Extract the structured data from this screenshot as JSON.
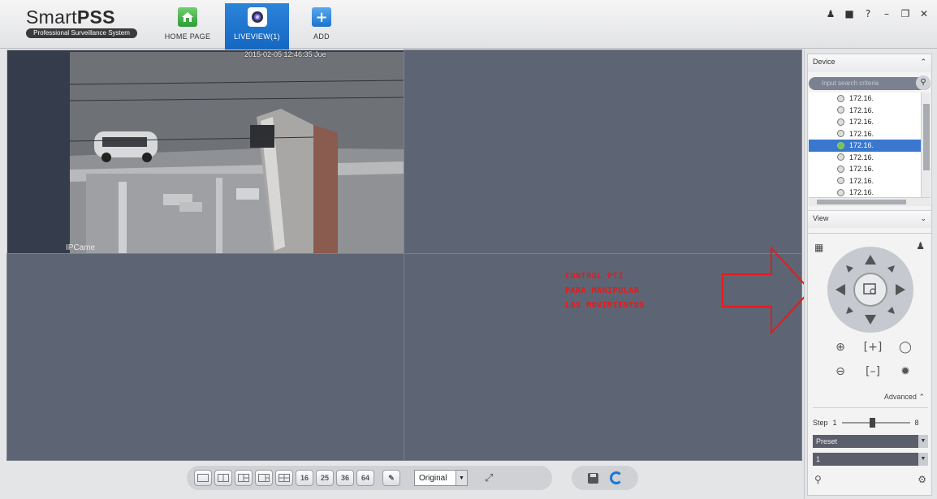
{
  "app": {
    "logo_text_light": "Smart",
    "logo_text_bold": "PSS",
    "logo_subtitle": "Professional Surveillance System"
  },
  "nav": {
    "home": "HOME PAGE",
    "liveview": "LIVEVIEW(1)",
    "add": "ADD"
  },
  "window_controls": [
    "user-icon",
    "lock-icon",
    "help-icon",
    "minimize-icon",
    "restore-icon",
    "close-icon"
  ],
  "video": {
    "timestamp": "2015-02-05 12:46:35 Jue",
    "camera_label": "IPCame"
  },
  "annotation": {
    "lines": [
      "CONTROL PTZ",
      "PARA MANIPULAR",
      "LOS MOVIMIENTOS"
    ],
    "color": "#e41b1b"
  },
  "toolbar": {
    "layout_numbers": [
      "16",
      "25",
      "36",
      "64"
    ],
    "stream_select": "Original"
  },
  "device_panel": {
    "title": "Device",
    "search_placeholder": "Input search criteria",
    "devices": [
      "172.16.",
      "172.16.",
      "172.16.",
      "172.16.",
      "172.16.",
      "172.16.",
      "172.16.",
      "172.16.",
      "172.16."
    ],
    "selected_index": 4,
    "view_title": "View"
  },
  "ptz": {
    "advanced_label": "Advanced",
    "step_label": "Step",
    "step_min": "1",
    "step_max": "8",
    "step_value_fraction": 0.45,
    "preset_label": "Preset",
    "preset_value": "1"
  },
  "colors": {
    "accent": "#1467c2",
    "video_bg": "#5d6474",
    "selected_row": "#3a77cf"
  }
}
